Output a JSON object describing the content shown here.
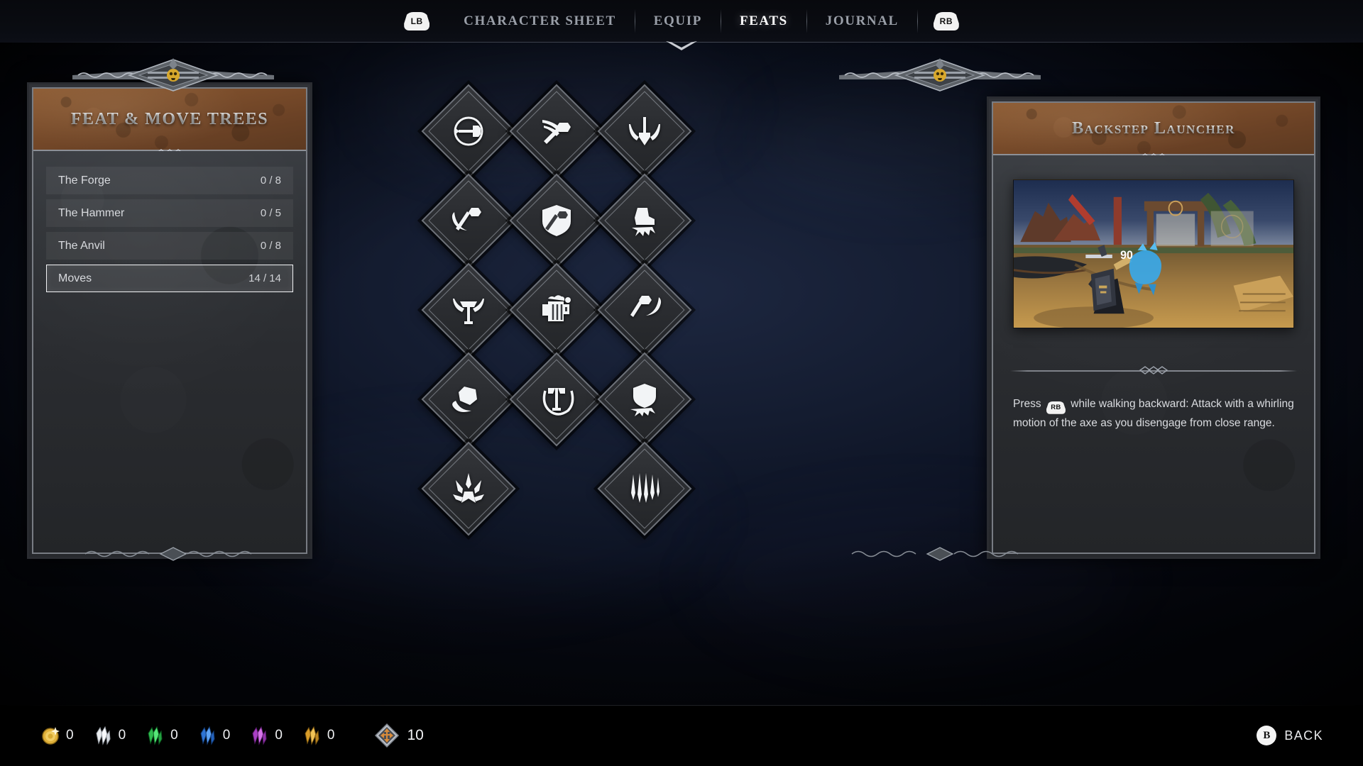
{
  "nav": {
    "left_bumper": "LB",
    "right_bumper": "RB",
    "tabs": [
      {
        "label": "CHARACTER SHEET",
        "active": false
      },
      {
        "label": "EQUIP",
        "active": false
      },
      {
        "label": "FEATS",
        "active": true
      },
      {
        "label": "JOURNAL",
        "active": false
      }
    ]
  },
  "left_panel": {
    "title": "FEAT & MOVE TREES",
    "rows": [
      {
        "name": "The Forge",
        "count": "0 / 8",
        "selected": false
      },
      {
        "name": "The Hammer",
        "count": "0 / 5",
        "selected": false
      },
      {
        "name": "The Anvil",
        "count": "0 / 8",
        "selected": false
      },
      {
        "name": "Moves",
        "count": "14 / 14",
        "selected": true
      }
    ]
  },
  "right_panel": {
    "title": "Backstep Launcher",
    "preview_caption": "90",
    "description_before": "Press ",
    "description_bumper": "RB",
    "description_after": " while walking backward: Attack with a whirling motion of the axe as you disengage from close range."
  },
  "skill_tree": {
    "nodes": [
      {
        "id": "n1",
        "icon": "hammer-circle-icon",
        "col": 0,
        "row": 0
      },
      {
        "id": "n2",
        "icon": "axe-swipe-icon",
        "col": 1,
        "row": 0
      },
      {
        "id": "n3",
        "icon": "horned-dagger-icon",
        "col": 2,
        "row": 0
      },
      {
        "id": "n4",
        "icon": "crescent-axe-icon",
        "col": 0,
        "row": 1
      },
      {
        "id": "n5",
        "icon": "shield-axe-icon",
        "col": 1,
        "row": 1
      },
      {
        "id": "n6",
        "icon": "boot-stomp-icon",
        "col": 2,
        "row": 1
      },
      {
        "id": "n7",
        "icon": "scythe-axe-icon",
        "col": 0,
        "row": 2
      },
      {
        "id": "n8",
        "icon": "beer-mug-icon",
        "col": 1,
        "row": 2
      },
      {
        "id": "n9",
        "icon": "uppercut-axe-icon",
        "col": 2,
        "row": 2
      },
      {
        "id": "n10",
        "icon": "rock-crescent-icon",
        "col": 0,
        "row": 3
      },
      {
        "id": "n11",
        "icon": "spin-axe-icon",
        "col": 1,
        "row": 3
      },
      {
        "id": "n12",
        "icon": "shield-bash-icon",
        "col": 2,
        "row": 3
      },
      {
        "id": "n13",
        "icon": "ground-slam-icon",
        "col": 0,
        "row": 4
      },
      {
        "id": "n14",
        "icon": "falling-strike-icon",
        "col": 2,
        "row": 4
      }
    ]
  },
  "bottom_bar": {
    "currencies": [
      {
        "icon": "gold-coin-icon",
        "value": "0",
        "color": "#e8b93c"
      },
      {
        "icon": "white-crystal-icon",
        "value": "0",
        "color": "#e9ecef"
      },
      {
        "icon": "green-crystal-icon",
        "value": "0",
        "color": "#35d45a"
      },
      {
        "icon": "blue-crystal-icon",
        "value": "0",
        "color": "#3b87e8"
      },
      {
        "icon": "purple-crystal-icon",
        "value": "0",
        "color": "#c457d8"
      },
      {
        "icon": "gold-crystal-icon",
        "value": "0",
        "color": "#e5a82e"
      }
    ],
    "feat_points": {
      "icon": "feat-point-icon",
      "value": "10"
    },
    "back": {
      "button": "B",
      "label": "BACK"
    }
  }
}
